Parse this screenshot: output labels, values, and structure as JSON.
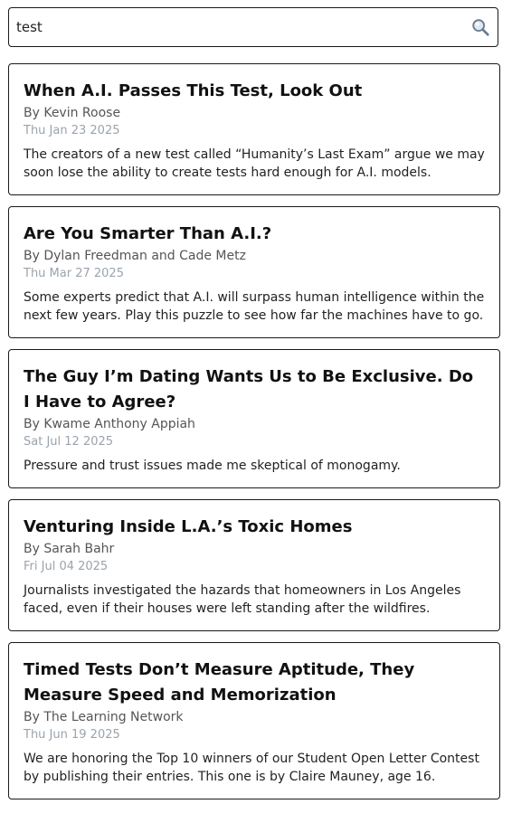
{
  "search": {
    "value": "test",
    "icon": "search-icon"
  },
  "results": [
    {
      "title": "When A.I. Passes This Test, Look Out",
      "byline": "By Kevin Roose",
      "date": "Thu Jan 23 2025",
      "summary": "The creators of a new test called “Humanity’s Last Exam” argue we may soon lose the ability to create tests hard enough for A.I. models."
    },
    {
      "title": "Are You Smarter Than A.I.?",
      "byline": "By Dylan Freedman and Cade Metz",
      "date": "Thu Mar 27 2025",
      "summary": "Some experts predict that A.I. will surpass human intelligence within the next few years. Play this puzzle to see how far the machines have to go."
    },
    {
      "title": "The Guy I’m Dating Wants Us to Be Exclusive. Do I Have to Agree?",
      "byline": "By Kwame Anthony Appiah",
      "date": "Sat Jul 12 2025",
      "summary": "Pressure and trust issues made me skeptical of monogamy."
    },
    {
      "title": "Venturing Inside L.A.’s Toxic Homes",
      "byline": "By Sarah Bahr",
      "date": "Fri Jul 04 2025",
      "summary": "Journalists investigated the hazards that homeowners in Los Angeles faced, even if their houses were left standing after the wildfires."
    },
    {
      "title": "Timed Tests Don’t Measure Aptitude, They Measure Speed and Memorization",
      "byline": "By The Learning Network",
      "date": "Thu Jun 19 2025",
      "summary": "We are honoring the Top 10 winners of our Student Open Letter Contest by publishing their entries. This one is by Claire Mauney, age 16."
    }
  ]
}
